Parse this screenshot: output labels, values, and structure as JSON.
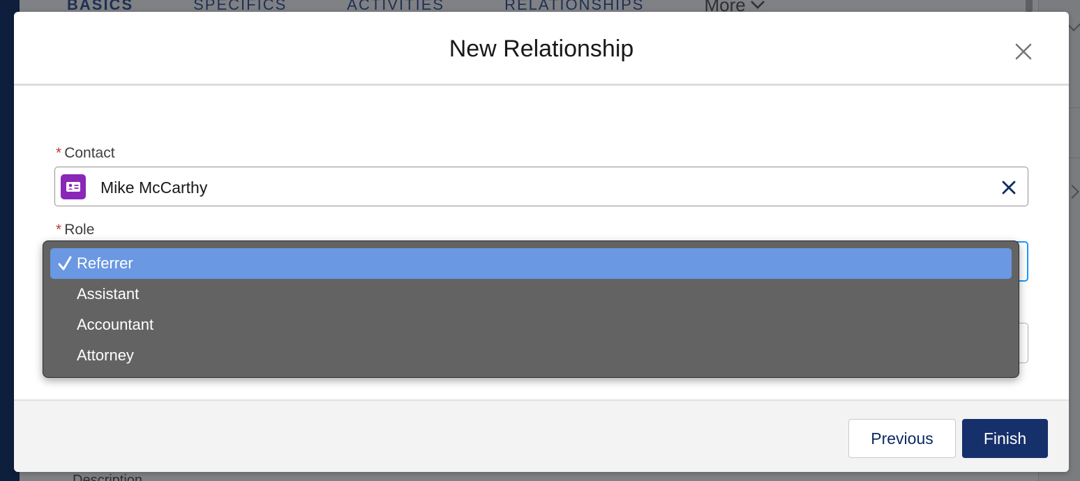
{
  "background": {
    "tabs": [
      "BASICS",
      "SPECIFICS",
      "ACTIVITIES",
      "RELATIONSHIPS"
    ],
    "more_label": "More",
    "description_label": "Description"
  },
  "modal": {
    "title": "New Relationship",
    "close_icon": "close-icon",
    "fields": {
      "contact": {
        "label": "Contact",
        "required_marker": "*",
        "value": "Mike McCarthy",
        "icon": "contact-card-icon"
      },
      "role": {
        "label": "Role",
        "required_marker": "*",
        "selected": "Referrer",
        "options": [
          "Referrer",
          "Assistant",
          "Accountant",
          "Attorney"
        ]
      }
    },
    "footer": {
      "previous_label": "Previous",
      "finish_label": "Finish"
    }
  },
  "colors": {
    "accent": "#16306b",
    "contact_icon_bg": "#8a27b8",
    "required": "#c23934",
    "selected_option": "#6a98e2",
    "dropdown_bg": "#636363"
  }
}
